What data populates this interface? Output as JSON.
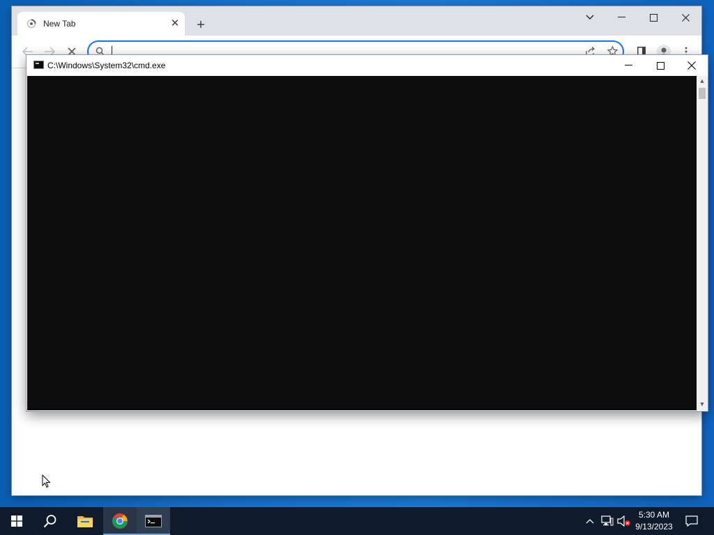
{
  "chrome": {
    "tab": {
      "title": "New Tab",
      "favicon": "loading-spinner-icon"
    },
    "new_tab_icon": "plus-icon",
    "omnibox": {
      "value": "",
      "placeholder": ""
    },
    "toolbar_icons": [
      "back-arrow-icon",
      "forward-arrow-icon",
      "stop-loading-icon",
      "search-icon",
      "share-icon",
      "bookmark-star-icon",
      "side-panel-icon",
      "profile-icon",
      "menu-kebab-icon"
    ]
  },
  "cmd": {
    "title": "C:\\Windows\\System32\\cmd.exe",
    "console_text": ""
  },
  "taskbar": {
    "apps": [
      "start-windows-icon",
      "search-icon",
      "file-explorer-icon",
      "chrome-icon",
      "cmd-icon"
    ],
    "active_app": "cmd-icon",
    "tray_icons": [
      "chevron-up-icon",
      "network-icon",
      "volume-muted-icon",
      "notification-icon"
    ],
    "time": "5:30 AM",
    "date": "9/13/2023"
  },
  "colors": {
    "accent": "#1a73e8",
    "console_bg": "#0c0c0c",
    "taskbar_bg": "#0f1a2a",
    "desktop": "#1673cf"
  }
}
